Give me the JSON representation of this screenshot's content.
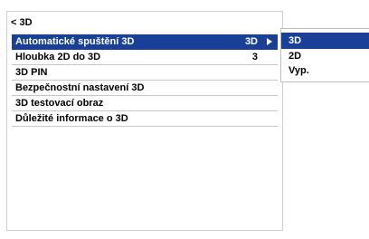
{
  "header": {
    "back_label": "< 3D"
  },
  "menu": {
    "items": [
      {
        "label": "Automatické spuštění 3D",
        "value": "3D"
      },
      {
        "label": "Hloubka 2D do 3D",
        "value": "3"
      },
      {
        "label": "3D PIN",
        "value": ""
      },
      {
        "label": "Bezpečnostní nastavení 3D",
        "value": ""
      },
      {
        "label": "3D testovací obraz",
        "value": ""
      },
      {
        "label": "Důležité informace o 3D",
        "value": ""
      }
    ]
  },
  "submenu": {
    "options": [
      "3D",
      "2D",
      "Vyp."
    ]
  },
  "colors": {
    "highlight": "#1a3f97",
    "row_divider": "#c6c6c6"
  },
  "icons": {
    "submenu_indicator": "triangle-right-icon"
  }
}
